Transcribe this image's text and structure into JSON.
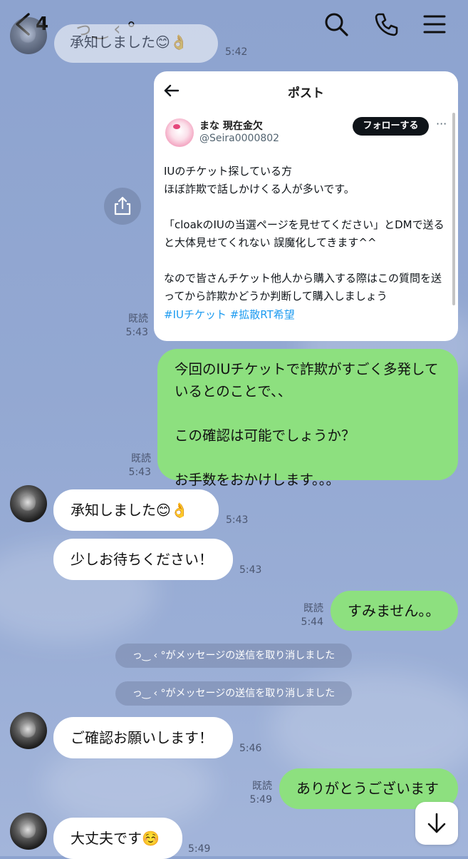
{
  "header": {
    "unread_count": "4",
    "contact_name": "っ‿ ‹ °",
    "icons": [
      "back-chevron-icon",
      "search-icon",
      "phone-icon",
      "menu-icon"
    ]
  },
  "top_partial": {
    "text": "承知しました😊👌",
    "time": "5:42"
  },
  "post_card": {
    "header_title": "ポスト",
    "user_name": "まな 現在金欠",
    "handle": "@Seira0000802",
    "follow_label": "フォローする",
    "more": "···",
    "body": "IUのチケット探している方\nほぼ詐欺で話しかけくる人が多いです。\n\n「cloakのIUの当選ページを見せてください」とDMで送ると大体見せてくれない 誤魔化してきます^^\n\nなので皆さんチケット他人から購入する際はこの質問を送ってから詐欺かどうか判断して購入しましょう",
    "hashtags": "#IUチケット #拡散RT希望",
    "read": "既読",
    "time": "5:43"
  },
  "messages": {
    "m1": {
      "text": "今回のIUチケットで詐欺がすごく多発しているとのことで、、\n\nこの確認は可能でしょうか？\n\nお手数をおかけします。。。",
      "read": "既読",
      "time": "5:43"
    },
    "m2": {
      "text": "承知しました😊👌",
      "time": "5:43"
    },
    "m3": {
      "text": "少しお待ちください！",
      "time": "5:43"
    },
    "m4": {
      "text": "すみません。。",
      "read": "既読",
      "time": "5:44"
    },
    "sys1": "っ‿ ‹ °がメッセージの送信を取り消しました",
    "sys2": "っ‿ ‹ °がメッセージの送信を取り消しました",
    "m5": {
      "text": "ご確認お願いします！",
      "time": "5:46"
    },
    "m6": {
      "text": "ありがとうございます",
      "read": "既読",
      "time": "5:49"
    },
    "m7": {
      "text": "大丈夫です☺️",
      "time": "5:49"
    }
  },
  "colors": {
    "background": "#93a8d2",
    "sent_bubble": "#8de07f",
    "received_bubble": "#ffffff",
    "hashtag": "#1d9bf0"
  }
}
